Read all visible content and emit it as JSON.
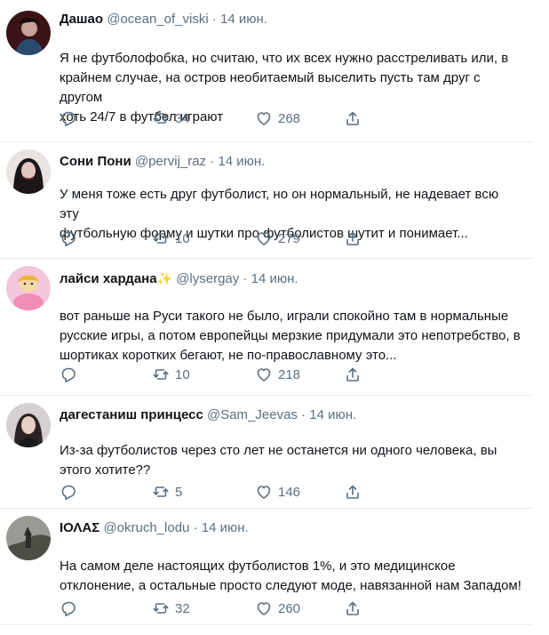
{
  "tweets": [
    {
      "name": "Дашао",
      "handle": "@ocean_of_viski",
      "sep": "·",
      "date": "14 июн.",
      "line1": "Я не футболофобка, но считаю, что их всех нужно расстреливать или, в",
      "line2": "крайнем случае, на остров необитаемый выселить пусть там друг с другом",
      "line3": "хоть 24/7 в футбол играют",
      "retweets": "34",
      "likes": "268"
    },
    {
      "name": "Сони Пони",
      "handle": "@pervij_raz",
      "sep": "·",
      "date": "14 июн.",
      "line1": "У меня тоже есть друг футболист, но он нормальный, не надевает всю эту",
      "line2": "футбольную форму и шутки про футболистов шутит и понимает...",
      "retweets": "10",
      "likes": "279"
    },
    {
      "name": "лайси хардана",
      "emoji": "✨",
      "handle": "@lysergay",
      "sep": "·",
      "date": "14 июн.",
      "line1": "вот раньше на Руси такого не было, играли спокойно там в нормальные",
      "line2": "русские игры, а потом европейцы мерзкие придумали это непотребство, в",
      "line3": "шортиках коротких бегают, не по-православному это...",
      "retweets": "10",
      "likes": "218"
    },
    {
      "name": "дагестаниш принцесс",
      "handle": "@Sam_Jeevas",
      "sep": "·",
      "date": "14 июн.",
      "line1": "Из-за футболистов через сто лет не останется ни одного человека, вы",
      "line2": "этого хотите??",
      "retweets": "5",
      "likes": "146"
    },
    {
      "name": "ΙΟΛΑΣ",
      "handle": "@okruch_lodu",
      "sep": "·",
      "date": "14 июн.",
      "line1": "На самом деле настоящих футболистов 1%, и это медицинское",
      "line2": "отклонение, а остальные просто следуют моде, навязанной нам Западом!",
      "retweets": "32",
      "likes": "260"
    }
  ],
  "icons": {
    "reply": "reply-icon",
    "retweet": "retweet-icon",
    "like": "heart-icon",
    "share": "share-icon"
  },
  "colors": {
    "text": "#0f1419",
    "secondary": "#5b7083",
    "divider": "#e6ecf0"
  }
}
